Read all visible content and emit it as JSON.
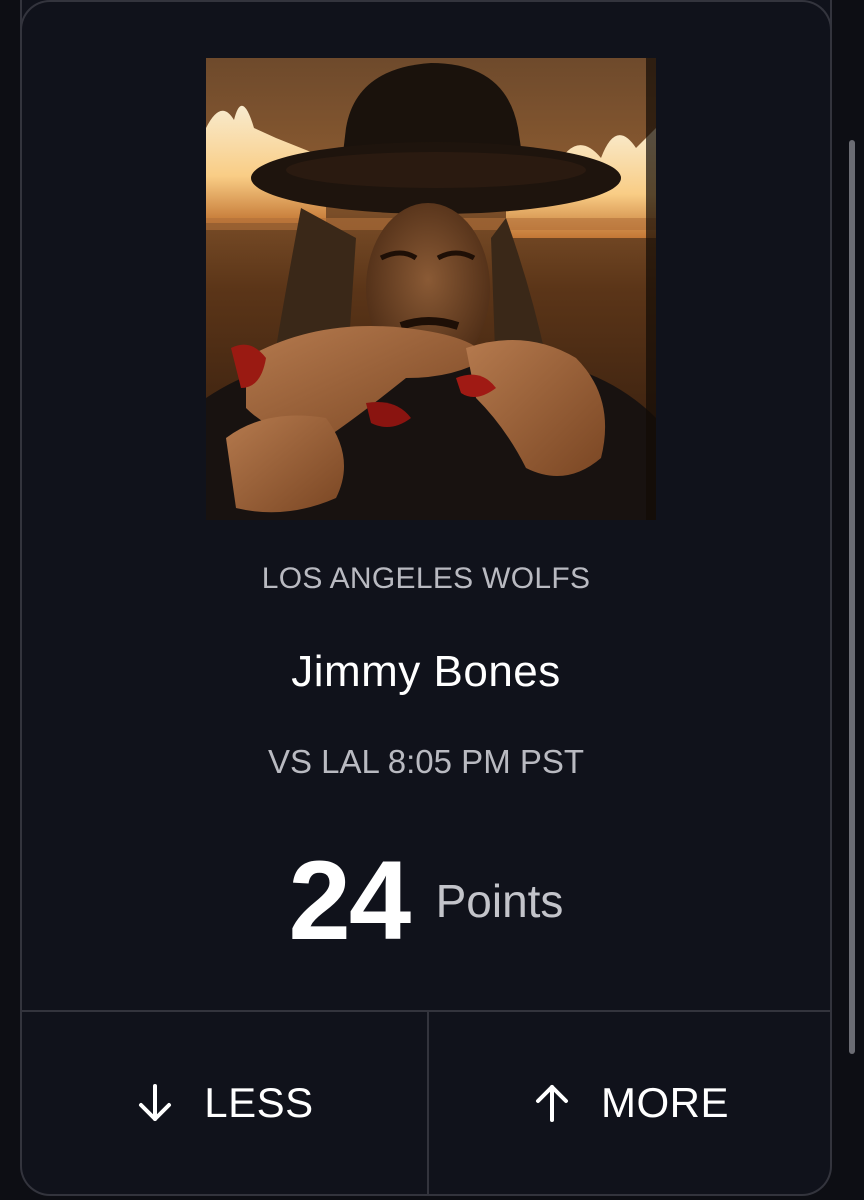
{
  "card": {
    "team": "LOS ANGELES WOLFS",
    "player_name": "Jimmy Bones",
    "matchup": "VS LAL 8:05 PM PST",
    "stat_value": "24",
    "stat_unit": "Points"
  },
  "actions": {
    "less_label": "LESS",
    "less_icon": "arrow-down-icon",
    "more_label": "MORE",
    "more_icon": "arrow-up-icon"
  },
  "colors": {
    "background": "#0d0e14",
    "card": "#10121b",
    "border": "#33343d",
    "text_primary": "#ffffff",
    "text_secondary": "#b9bac1"
  }
}
